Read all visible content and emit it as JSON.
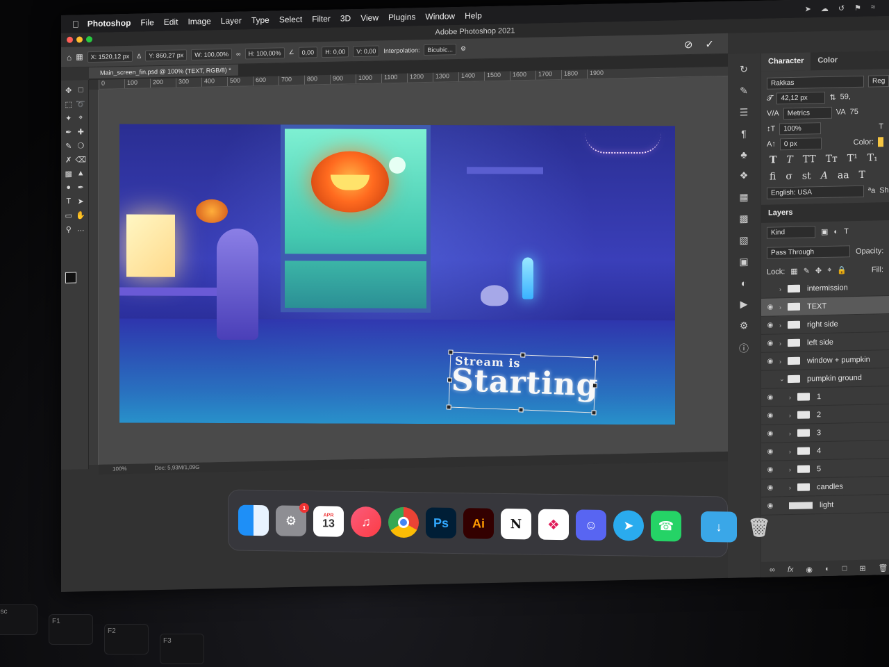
{
  "menubar": {
    "app": "Photoshop",
    "items": [
      "File",
      "Edit",
      "Image",
      "Layer",
      "Type",
      "Select",
      "Filter",
      "3D",
      "View",
      "Plugins",
      "Window",
      "Help"
    ]
  },
  "window": {
    "title": "Adobe Photoshop 2021"
  },
  "options": {
    "x": "X: 1520,12 px",
    "y": "Y: 860,27 px",
    "w": "W: 100,00%",
    "h": "H: 100,00%",
    "angle": "0,00",
    "hskew": "H: 0,00",
    "vskew": "V: 0,00",
    "interpolation_label": "Interpolation:",
    "interpolation_value": "Bicubic..."
  },
  "document": {
    "tab": "Main_screen_fin.psd @ 100% (TEXT, RGB/8) *"
  },
  "ruler": [
    "0",
    "100",
    "200",
    "300",
    "400",
    "500",
    "600",
    "700",
    "800",
    "900",
    "1000",
    "1100",
    "1200",
    "1300",
    "1400",
    "1500",
    "1600",
    "1700",
    "1800",
    "1900"
  ],
  "artwork": {
    "line1": "Stream is",
    "line2": "Starting"
  },
  "status": {
    "zoom": "100%",
    "doc": "Doc: 5,93M/1,09G"
  },
  "character": {
    "tabs": [
      "Character",
      "Color"
    ],
    "font": "Rakkas",
    "style": "Reg",
    "size": "42,12 px",
    "leading": "59,",
    "kerning": "Metrics",
    "tracking": "75",
    "vscale": "100%",
    "baseline": "0 px",
    "color_label": "Color:",
    "language": "English: USA",
    "aa": "Sha"
  },
  "layers": {
    "title": "Layers",
    "kind": "Kind",
    "blend": "Pass Through",
    "opacity_label": "Opacity:",
    "lock_label": "Lock:",
    "fill_label": "Fill:",
    "items": [
      {
        "name": "intermission"
      },
      {
        "name": "TEXT"
      },
      {
        "name": "right side"
      },
      {
        "name": "left side"
      },
      {
        "name": "window + pumpkin"
      },
      {
        "name": "pumpkin ground"
      },
      {
        "name": "1"
      },
      {
        "name": "2"
      },
      {
        "name": "3"
      },
      {
        "name": "4"
      },
      {
        "name": "5"
      },
      {
        "name": "candles"
      },
      {
        "name": "light"
      }
    ]
  },
  "dock": {
    "calendar_month": "APR",
    "calendar_day": "13",
    "ps": "Ps",
    "ai": "Ai",
    "notion": "N",
    "badge": "1"
  },
  "keys": [
    "esc",
    "F1",
    "F2",
    "F3"
  ]
}
